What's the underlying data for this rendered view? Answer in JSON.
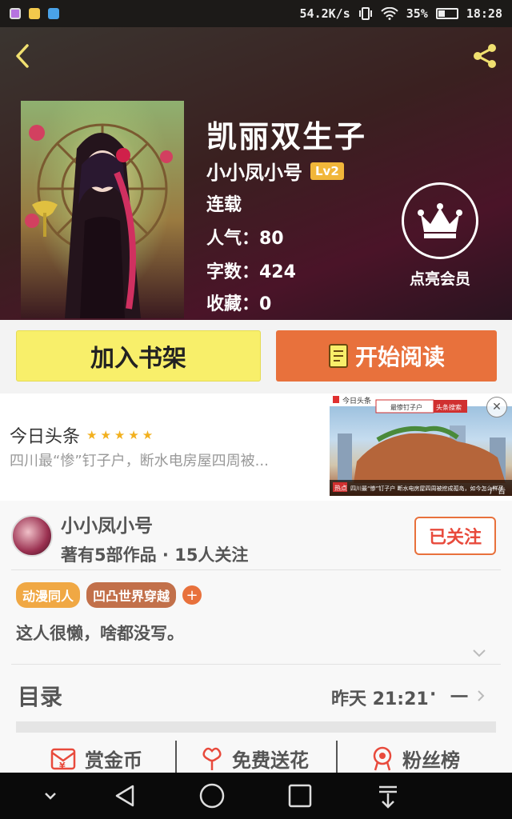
{
  "status_bar": {
    "net_speed": "54.2K/s",
    "battery": "35%",
    "time": "18:28"
  },
  "book": {
    "title": "凯丽双生子",
    "author": "小小凤小号",
    "level": "Lv2",
    "status": "连载",
    "popularity": "人气：80",
    "word_count": "字数：424",
    "favorites": "收藏：0"
  },
  "vip": {
    "label": "点亮会员"
  },
  "actions": {
    "add_shelf": "加入书架",
    "start_reading": "开始阅读"
  },
  "ad": {
    "source": "今日头条",
    "rating_stars": "★★★★★",
    "headline": "四川最“惨”钉子户，断水电房屋四周被...",
    "image_search_text": "最惨钉子户",
    "image_search_btn": "头条搜索",
    "image_app_label": "今日头条",
    "image_caption": "四川最“惨”钉子户 断水电房屋四周被挖成孤岛，如今怎么样了",
    "image_tag": "热点",
    "ad_label": "广告",
    "close": "✕"
  },
  "author_section": {
    "name": "小小凤小号",
    "stats": "著有5部作品 · 15人关注",
    "follow_label": "已关注",
    "tags": [
      {
        "label": "动漫同人",
        "color": "#f0a844"
      },
      {
        "label": "凹凸世界穿越",
        "color": "#c2704a"
      }
    ],
    "tag_add": "+",
    "bio": "这人很懒，啥都没写。"
  },
  "toc": {
    "title": "目录",
    "updated": "昨天 21:21",
    "separator": "·",
    "latest": "一"
  },
  "bottom_actions": [
    {
      "label": "赏金币",
      "icon": "coin-envelope-icon"
    },
    {
      "label": "免费送花",
      "icon": "flower-icon"
    },
    {
      "label": "粉丝榜",
      "icon": "ranking-medal-icon"
    }
  ],
  "colors": {
    "accent_orange": "#e8713c",
    "shelf_yellow": "#f8ef6a",
    "star_gold": "#f2b01e"
  }
}
